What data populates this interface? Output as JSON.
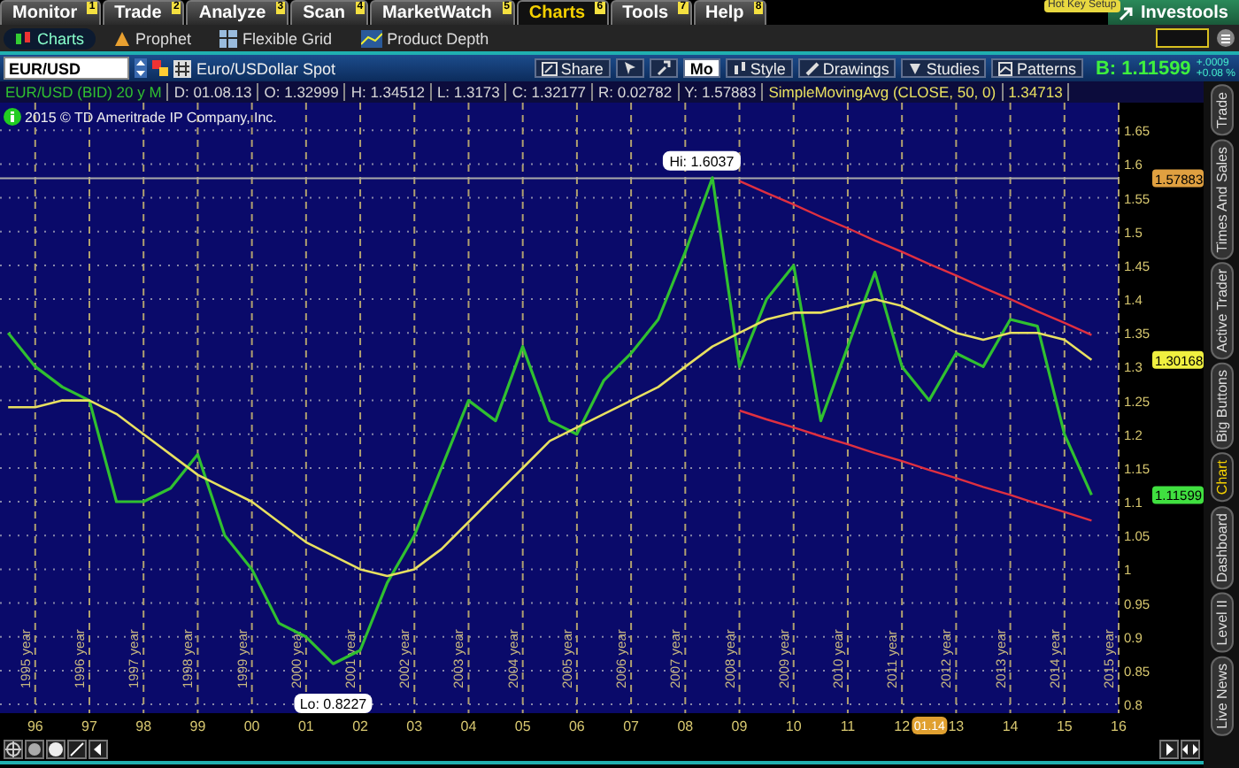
{
  "menu_tabs": [
    {
      "label": "Monitor",
      "badge": "1",
      "selected": false
    },
    {
      "label": "Trade",
      "badge": "2",
      "selected": false
    },
    {
      "label": "Analyze",
      "badge": "3",
      "selected": false
    },
    {
      "label": "Scan",
      "badge": "4",
      "selected": false
    },
    {
      "label": "MarketWatch",
      "badge": "5",
      "selected": false
    },
    {
      "label": "Charts",
      "badge": "6",
      "selected": true
    },
    {
      "label": "Tools",
      "badge": "7",
      "selected": false
    },
    {
      "label": "Help",
      "badge": "8",
      "selected": false
    }
  ],
  "hot_key_setup": "Hot Key Setup",
  "investools_button": "Investools",
  "sub_tabs": [
    {
      "label": "Charts",
      "kind": "charts",
      "selected": true
    },
    {
      "label": "Prophet",
      "kind": "prophet",
      "selected": false
    },
    {
      "label": "Flexible Grid",
      "kind": "grid",
      "selected": false
    },
    {
      "label": "Product Depth",
      "kind": "depth",
      "selected": false
    }
  ],
  "symbol": {
    "value": "EUR/USD",
    "description": "Euro/USDollar Spot"
  },
  "toolbar": [
    {
      "kind": "share",
      "label": "Share"
    },
    {
      "kind": "drawing_tools"
    },
    {
      "kind": "settings"
    },
    {
      "kind": "aggregation",
      "label": "Mo"
    },
    {
      "kind": "style",
      "label": "Style"
    },
    {
      "kind": "drawings",
      "label": "Drawings"
    },
    {
      "kind": "studies",
      "label": "Studies"
    },
    {
      "kind": "patterns",
      "label": "Patterns"
    }
  ],
  "quote": {
    "bid": "B: 1.11599",
    "change": "+.0009",
    "change_percent": "+0.08 %"
  },
  "info_strip": {
    "bar_values": [
      "D: 01.08.13",
      "O: 1.32999",
      "H: 1.34512",
      "L: 1.3173",
      "C: 1.32177",
      "R: 0.02782",
      "Y: 1.57883"
    ],
    "study_value": "1.34713"
  },
  "copyright": "2015 © TD Ameritrade IP Company, Inc.",
  "side_tabs": [
    {
      "label": "Trade",
      "selected": false
    },
    {
      "label": "Times And Sales",
      "selected": false
    },
    {
      "label": "Active Trader",
      "selected": false
    },
    {
      "label": "Big Buttons",
      "selected": false
    },
    {
      "label": "Chart",
      "selected": true
    },
    {
      "label": "Dashboard",
      "selected": false
    },
    {
      "label": "Level II",
      "selected": false
    },
    {
      "label": "Live News",
      "selected": false
    }
  ],
  "year_markers": [
    "1995 year",
    "1996 year",
    "1997 year",
    "1998 year",
    "1999 year",
    "2000 year",
    "2001 year",
    "2002 year",
    "2003 year",
    "2004 year",
    "2005 year",
    "2006 year",
    "2007 year",
    "2008 year",
    "2009 year",
    "2010 year",
    "2011 year",
    "2012 year",
    "2013 year",
    "2014 year",
    "2015 year"
  ],
  "chart_data": {
    "type": "line",
    "grid": true,
    "xlim": [
      1995.35,
      2016.0
    ],
    "ylim": [
      0.787,
      1.691
    ],
    "x": [
      1995.5,
      1996,
      1996.5,
      1997,
      1997.5,
      1998,
      1998.5,
      1999,
      1999.5,
      2000,
      2000.5,
      2001,
      2001.5,
      2002,
      2002.5,
      2003,
      2003.5,
      2004,
      2004.5,
      2005,
      2005.5,
      2006,
      2006.5,
      2007,
      2007.5,
      2008,
      2008.5,
      2009,
      2009.5,
      2010,
      2010.5,
      2011,
      2011.5,
      2012,
      2012.5,
      2013,
      2013.5,
      2014,
      2014.5,
      2015,
      2015.5
    ],
    "series": [
      {
        "name": "EUR/USD (BID) 20 y M",
        "color": "#30c030",
        "values": [
          1.35,
          1.3,
          1.27,
          1.25,
          1.1,
          1.1,
          1.12,
          1.17,
          1.05,
          1.0,
          0.92,
          0.9,
          0.86,
          0.88,
          0.98,
          1.05,
          1.15,
          1.25,
          1.22,
          1.33,
          1.22,
          1.2,
          1.28,
          1.32,
          1.37,
          1.47,
          1.58,
          1.3,
          1.4,
          1.45,
          1.22,
          1.33,
          1.44,
          1.3,
          1.25,
          1.32,
          1.3,
          1.37,
          1.36,
          1.2,
          1.11
        ]
      },
      {
        "name": "SimpleMovingAvg (CLOSE, 50, 0)",
        "color": "#e8e060",
        "values": [
          1.24,
          1.24,
          1.25,
          1.25,
          1.23,
          1.2,
          1.17,
          1.14,
          1.12,
          1.1,
          1.07,
          1.04,
          1.02,
          1.0,
          0.99,
          1.0,
          1.03,
          1.07,
          1.11,
          1.15,
          1.19,
          1.21,
          1.23,
          1.25,
          1.27,
          1.3,
          1.33,
          1.35,
          1.37,
          1.38,
          1.38,
          1.39,
          1.4,
          1.39,
          1.37,
          1.35,
          1.34,
          1.35,
          1.35,
          1.34,
          1.31
        ]
      },
      {
        "color": "#e03040",
        "values": [
          null,
          null,
          null,
          null,
          null,
          null,
          null,
          null,
          null,
          null,
          null,
          null,
          null,
          null,
          null,
          null,
          null,
          null,
          null,
          null,
          null,
          null,
          null,
          null,
          null,
          null,
          null,
          1.575,
          1.557,
          1.54,
          1.522,
          1.505,
          1.487,
          1.47,
          1.452,
          1.435,
          1.417,
          1.4,
          1.382,
          1.365,
          1.347
        ]
      },
      {
        "color": "#e03040",
        "values": [
          null,
          null,
          null,
          null,
          null,
          null,
          null,
          null,
          null,
          null,
          null,
          null,
          null,
          null,
          null,
          null,
          null,
          null,
          null,
          null,
          null,
          null,
          null,
          null,
          null,
          null,
          null,
          1.235,
          1.222,
          1.21,
          1.197,
          1.185,
          1.172,
          1.16,
          1.147,
          1.135,
          1.122,
          1.11,
          1.097,
          1.085,
          1.072
        ]
      }
    ],
    "xticks": [
      {
        "value": 1996,
        "label": "96"
      },
      {
        "value": 1997,
        "label": "97"
      },
      {
        "value": 1998,
        "label": "98"
      },
      {
        "value": 1999,
        "label": "99"
      },
      {
        "value": 2000,
        "label": "00"
      },
      {
        "value": 2001,
        "label": "01"
      },
      {
        "value": 2002,
        "label": "02"
      },
      {
        "value": 2003,
        "label": "03"
      },
      {
        "value": 2004,
        "label": "04"
      },
      {
        "value": 2005,
        "label": "05"
      },
      {
        "value": 2006,
        "label": "06"
      },
      {
        "value": 2007,
        "label": "07"
      },
      {
        "value": 2008,
        "label": "08"
      },
      {
        "value": 2009,
        "label": "09"
      },
      {
        "value": 2010,
        "label": "10"
      },
      {
        "value": 2011,
        "label": "11"
      },
      {
        "value": 2012,
        "label": "12"
      },
      {
        "value": 2013,
        "label": "13"
      },
      {
        "value": 2014,
        "label": "14"
      },
      {
        "value": 2015,
        "label": "15"
      },
      {
        "value": 2016,
        "label": "16"
      }
    ],
    "yticks": [
      {
        "value": 0.8,
        "label": "0.8"
      },
      {
        "value": 0.85,
        "label": "0.85"
      },
      {
        "value": 0.9,
        "label": "0.9"
      },
      {
        "value": 0.95,
        "label": "0.95"
      },
      {
        "value": 1,
        "label": "1"
      },
      {
        "value": 1.05,
        "label": "1.05"
      },
      {
        "value": 1.1,
        "label": "1.1"
      },
      {
        "value": 1.15,
        "label": "1.15"
      },
      {
        "value": 1.2,
        "label": "1.2"
      },
      {
        "value": 1.25,
        "label": "1.25"
      },
      {
        "value": 1.3,
        "label": "1.3"
      },
      {
        "value": 1.35,
        "label": "1.35"
      },
      {
        "value": 1.4,
        "label": "1.4"
      },
      {
        "value": 1.45,
        "label": "1.45"
      },
      {
        "value": 1.5,
        "label": "1.5"
      },
      {
        "value": 1.55,
        "label": "1.55"
      },
      {
        "value": 1.6,
        "label": "1.6"
      },
      {
        "value": 1.65,
        "label": "1.65"
      }
    ],
    "ref_lines": [
      {
        "axis": "y",
        "value": 1.57883,
        "label": "1.57883"
      }
    ],
    "annotations": [
      "Hi: 1.6037",
      "Lo: 0.8227",
      "1.30168",
      "1.11599",
      "01.14"
    ]
  }
}
